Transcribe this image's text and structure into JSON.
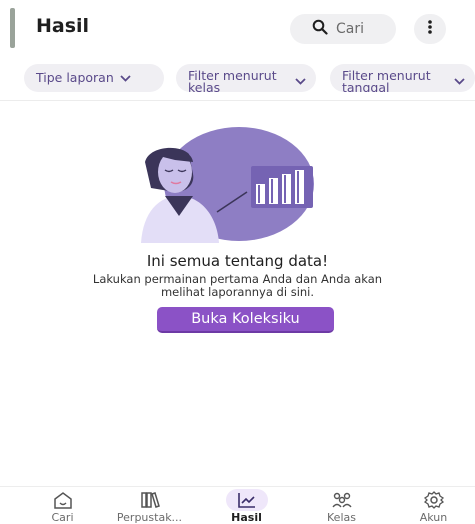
{
  "header": {
    "title": "Hasil",
    "search_label": "Cari",
    "search_icon": "search-icon",
    "more_icon": "more-vertical-icon"
  },
  "filters": [
    {
      "label": "Tipe laporan",
      "icon": "chevron-down-icon"
    },
    {
      "label": "Filter menurut kelas",
      "icon": "chevron-down-icon"
    },
    {
      "label": "Filter menurut tanggal",
      "icon": "chevron-down-icon"
    }
  ],
  "empty_state": {
    "title": "Ini semua tentang data!",
    "description": "Lakukan permainan pertama Anda dan Anda akan melihat laporannya di sini.",
    "button_label": "Buka Koleksiku"
  },
  "bottom_nav": [
    {
      "label": "Cari",
      "icon": "home-icon",
      "active": false
    },
    {
      "label": "Perpustak...",
      "icon": "library-icon",
      "active": false
    },
    {
      "label": "Hasil",
      "icon": "chart-icon",
      "active": true
    },
    {
      "label": "Kelas",
      "icon": "class-icon",
      "active": false
    },
    {
      "label": "Akun",
      "icon": "settings-icon",
      "active": false
    }
  ],
  "colors": {
    "accent": "#8b52c6",
    "chip_bg": "#f0eff3",
    "illustration_bg": "#8e7ec4",
    "active_nav_bg": "#efe7fa"
  }
}
